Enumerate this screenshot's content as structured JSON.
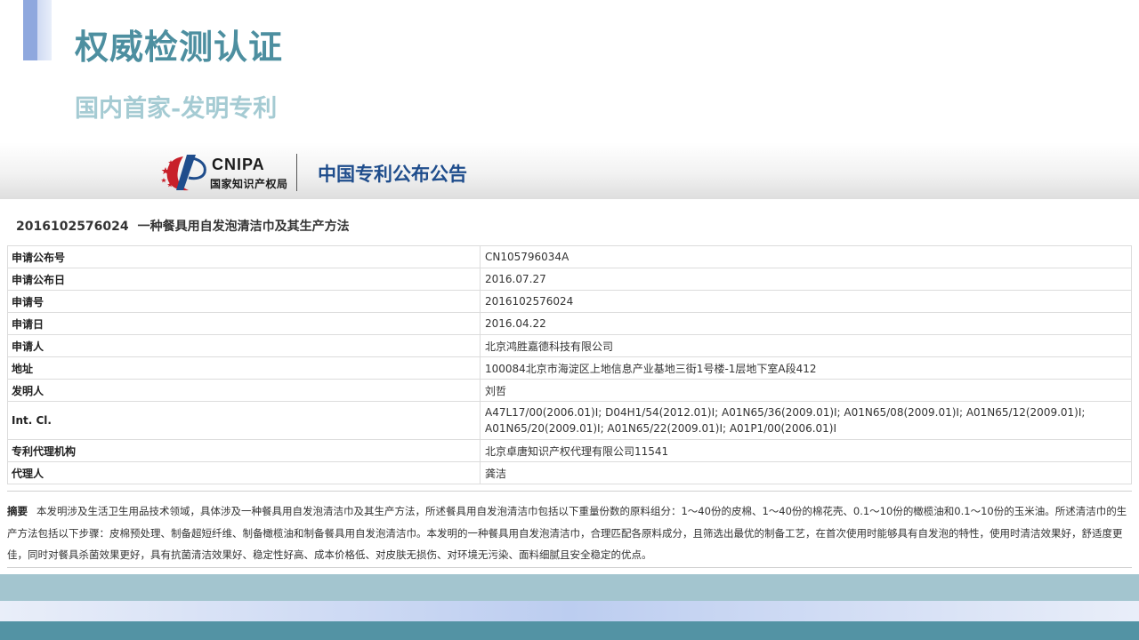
{
  "slide": {
    "title": "权威检测认证",
    "subtitle": "国内首家-发明专利"
  },
  "banner": {
    "logo_text": "CNIPA",
    "logo_cn": "国家知识产权局",
    "title": "中国专利公布公告"
  },
  "patent": {
    "number": "2016102576024",
    "name": "一种餐具用自发泡清洁巾及其生产方法"
  },
  "info_rows": [
    {
      "key": "申请公布号",
      "value": "CN105796034A"
    },
    {
      "key": "申请公布日",
      "value": "2016.07.27"
    },
    {
      "key": "申请号",
      "value": "2016102576024"
    },
    {
      "key": "申请日",
      "value": "2016.04.22"
    },
    {
      "key": "申请人",
      "value": "北京鸿胜嘉德科技有限公司"
    },
    {
      "key": "地址",
      "value": "100084北京市海淀区上地信息产业基地三街1号楼-1层地下室A段412"
    },
    {
      "key": "发明人",
      "value": "刘哲"
    },
    {
      "key": "Int. Cl.",
      "value": "A47L17/00(2006.01)I;  D04H1/54(2012.01)I;  A01N65/36(2009.01)I;  A01N65/08(2009.01)I;  A01N65/12(2009.01)I;",
      "value2": "A01N65/20(2009.01)I;  A01N65/22(2009.01)I;  A01P1/00(2006.01)I"
    },
    {
      "key": "专利代理机构",
      "value": "北京卓唐知识产权代理有限公司11541"
    },
    {
      "key": "代理人",
      "value": "龚洁"
    }
  ],
  "abstract": {
    "label": "摘要",
    "text": "本发明涉及生活卫生用品技术领域，具体涉及一种餐具用自发泡清洁巾及其生产方法，所述餐具用自发泡清洁巾包括以下重量份数的原料组分：1～40份的皮棉、1～40份的棉花壳、0.1～10份的橄榄油和0.1～10份的玉米油。所述清洁巾的生产方法包括以下步骤：皮棉预处理、制备超短纤维、制备橄榄油和制备餐具用自发泡清洁巾。本发明的一种餐具用自发泡清洁巾，合理匹配各原料成分，且筛选出最优的制备工艺，在首次使用时能够具有自发泡的特性，使用时清洁效果好，舒适度更佳，同时对餐具杀菌效果更好，具有抗菌清洁效果好、稳定性好高、成本价格低、对皮肤无损伤、对环境无污染、面料细腻且安全稳定的优点。"
  },
  "colors": {
    "title": "#4d8fa0",
    "subtitle": "#a5cbd3",
    "banner_title": "#1f4d8c",
    "footer_teal": "#5393a4",
    "footer_light": "#a3c5cf"
  }
}
